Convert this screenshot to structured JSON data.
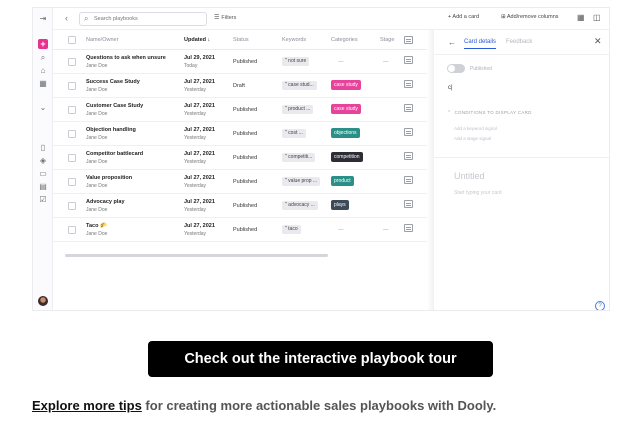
{
  "toolbar": {
    "search_placeholder": "Search playbooks",
    "filters_label": "Filters",
    "add_card_label": "+ Add a card",
    "add_remove_columns_label": "Add/remove columns"
  },
  "table": {
    "columns": [
      "Name/Owner",
      "Updated ↓",
      "Status",
      "Keywords",
      "Categories",
      "Stage"
    ],
    "rows": [
      {
        "name": "Questions to ask when unsure",
        "owner": "Jane Doe",
        "date": "Jul 29, 2021",
        "relative": "Today",
        "status": "Published",
        "keyword": "\" not sure",
        "category": "—",
        "stage": "—"
      },
      {
        "name": "Success Case Study",
        "owner": "Jane Doe",
        "date": "Jul 27, 2021",
        "relative": "Yesterday",
        "status": "Draft",
        "keyword": "\" case stud...",
        "category": "case study",
        "stage": ""
      },
      {
        "name": "Customer Case Study",
        "owner": "Jane Doe",
        "date": "Jul 27, 2021",
        "relative": "Yesterday",
        "status": "Published",
        "keyword": "\" product ...",
        "category": "case study",
        "stage": ""
      },
      {
        "name": "Objection handling",
        "owner": "Jane Doe",
        "date": "Jul 27, 2021",
        "relative": "Yesterday",
        "status": "Published",
        "keyword": "\" cost ...",
        "category": "objections",
        "stage": ""
      },
      {
        "name": "Competitor battlecard",
        "owner": "Jane Doe",
        "date": "Jul 27, 2021",
        "relative": "Yesterday",
        "status": "Published",
        "keyword": "\" competiti...",
        "category": "competition",
        "stage": ""
      },
      {
        "name": "Value proposition",
        "owner": "Jane Doe",
        "date": "Jul 27, 2021",
        "relative": "Yesterday",
        "status": "Published",
        "keyword": "\" value prop ...",
        "category": "product",
        "stage": ""
      },
      {
        "name": "Advocacy play",
        "owner": "Jane Doe",
        "date": "Jul 27, 2021",
        "relative": "Yesterday",
        "status": "Published",
        "keyword": "\" advocacy ...",
        "category": "plays",
        "stage": ""
      },
      {
        "name": "Taco 🌮",
        "owner": "Jane Doe",
        "date": "Jul 27, 2021",
        "relative": "Yesterday",
        "status": "Published",
        "keyword": "\" taco",
        "category": "—",
        "stage": "—"
      }
    ],
    "category_colors": {
      "case study": "#e8439b",
      "objections": "#2a8f86",
      "competition": "#2d2d35",
      "product": "#2a8f86",
      "plays": "#3d4a57"
    }
  },
  "panel": {
    "tab_active": "Card details",
    "tab_inactive": "Feedback",
    "toggle_label": "Published",
    "input_text": "c|",
    "conditions_heading": "CONDITIONS TO DISPLAY CARD",
    "keyword_signal_placeholder": "Add a keyword signal",
    "stage_signal_placeholder": "Add a stage signal",
    "title_placeholder": "Untitled",
    "body_placeholder": "Start typing your card"
  },
  "cta_label": "Check out the interactive playbook tour",
  "footer": {
    "link_text": "Explore more tips",
    "rest_text": " for creating more actionable sales playbooks with Dooly."
  },
  "colors": {
    "accent_pink": "#e8318f",
    "link_blue": "#2b5ad8"
  }
}
